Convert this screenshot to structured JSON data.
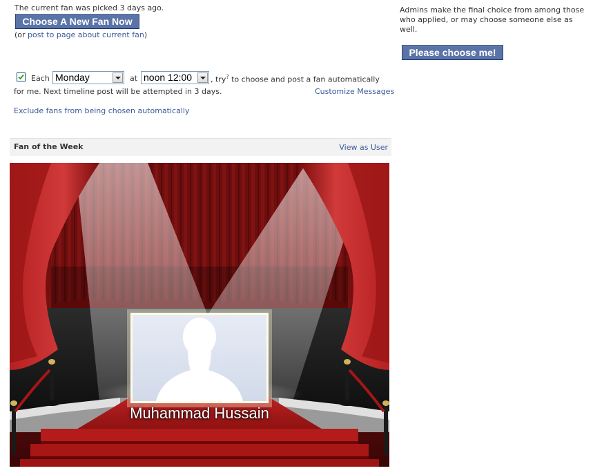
{
  "status": {
    "current_fan_text": "The current fan was picked 3 days ago.",
    "choose_button": "Choose A New Fan Now",
    "or_prefix": "(or ",
    "post_link": "post to page about current fan",
    "or_suffix": ")"
  },
  "schedule": {
    "checked": true,
    "each_label": "Each",
    "day_value": "Monday",
    "at_label": "at",
    "time_value": "noon 12:00",
    "try_prefix": ", try",
    "try_sup": "?",
    "try_suffix": " to choose and post a fan automatically",
    "line2": "for me. Next timeline post will be attempted in 3 days.",
    "customize_link": "Customize Messages",
    "exclude_link": "Exclude fans from being chosen automatically"
  },
  "section": {
    "title": "Fan of the Week",
    "view_link": "View as User"
  },
  "stage": {
    "fan_name": "Muhammad Hussain",
    "icon": "person-silhouette-icon"
  },
  "side": {
    "admin_note": [
      "Admins make the final choice from among those",
      "who applied, or may choose someone else as",
      "well."
    ],
    "apply_button": "Please choose me!"
  },
  "colors": {
    "link": "#3b5998",
    "button": "#5b74a8",
    "curtain": "#8e1212",
    "carpet": "#a31717"
  }
}
